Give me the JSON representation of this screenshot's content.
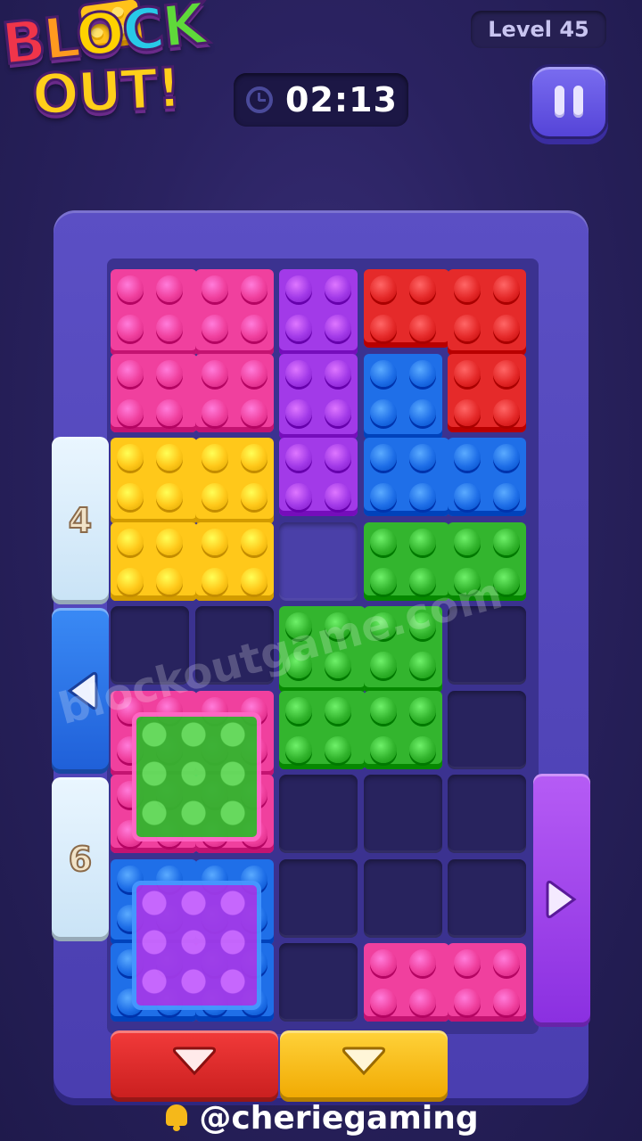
{
  "logo": {
    "line1": [
      "B",
      "L",
      "O",
      "C",
      "K"
    ],
    "line2": "OUT!"
  },
  "header": {
    "level_label": "Level 45",
    "timer": "02:13"
  },
  "colors": {
    "pink": "#f0409e",
    "purple": "#a23ae8",
    "red": "#e52a2a",
    "blue": "#1f6fe8",
    "yellow": "#ffc81a",
    "green": "#33b52e",
    "ice": "#dceefa"
  },
  "side_gates": {
    "left_top_ice_count": "4",
    "left_bottom_ice_count": "6"
  },
  "watermark": "blockoutgame.com",
  "credit": "@cheriegaming"
}
